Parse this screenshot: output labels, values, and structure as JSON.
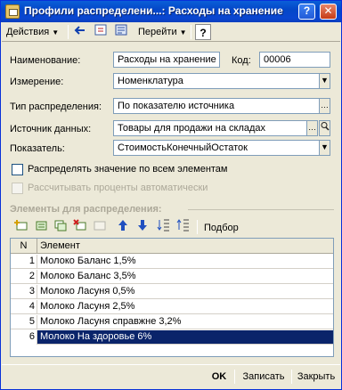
{
  "window": {
    "title": "Профили распределени...: Расходы на хранение",
    "help_btn": "?",
    "close_btn": "✕"
  },
  "toolbar": {
    "actions_label": "Действия",
    "goto_label": "Перейти",
    "help_icon_text": "?"
  },
  "form": {
    "name_label": "Наименование:",
    "name_value": "Расходы на хранение",
    "code_label": "Код:",
    "code_value": "00006",
    "dimension_label": "Измерение:",
    "dimension_value": "Номенклатура",
    "dist_type_label": "Тип распределения:",
    "dist_type_value": "По показателю источника",
    "source_label": "Источник данных:",
    "source_value": "Товары для продажи на складах",
    "indicator_label": "Показатель:",
    "indicator_value": "СтоимостьКонечныйОстаток",
    "distribute_all_label": "Распределять значение по всем элементам",
    "auto_percent_label": "Рассчитывать проценты автоматически"
  },
  "elements": {
    "section_title": "Элементы для распределения:",
    "selection_label": "Подбор",
    "col_number": "N",
    "col_element": "Элемент",
    "rows": [
      {
        "n": "1",
        "name": "Молоко Баланс 1,5%"
      },
      {
        "n": "2",
        "name": "Молоко Баланс 3,5%"
      },
      {
        "n": "3",
        "name": "Молоко Ласуня 0,5%"
      },
      {
        "n": "4",
        "name": "Молоко Ласуня 2,5%"
      },
      {
        "n": "5",
        "name": "Молоко Ласуня справжне 3,2%"
      },
      {
        "n": "6",
        "name": "Молоко На здоровье 6%"
      }
    ],
    "selected_row": 6
  },
  "footer": {
    "ok_label": "OK",
    "save_label": "Записать",
    "close_label": "Закрыть"
  },
  "colors": {
    "titlebar": "#0A46D0",
    "window_bg": "#ECE9D8",
    "selection": "#0A246A"
  }
}
